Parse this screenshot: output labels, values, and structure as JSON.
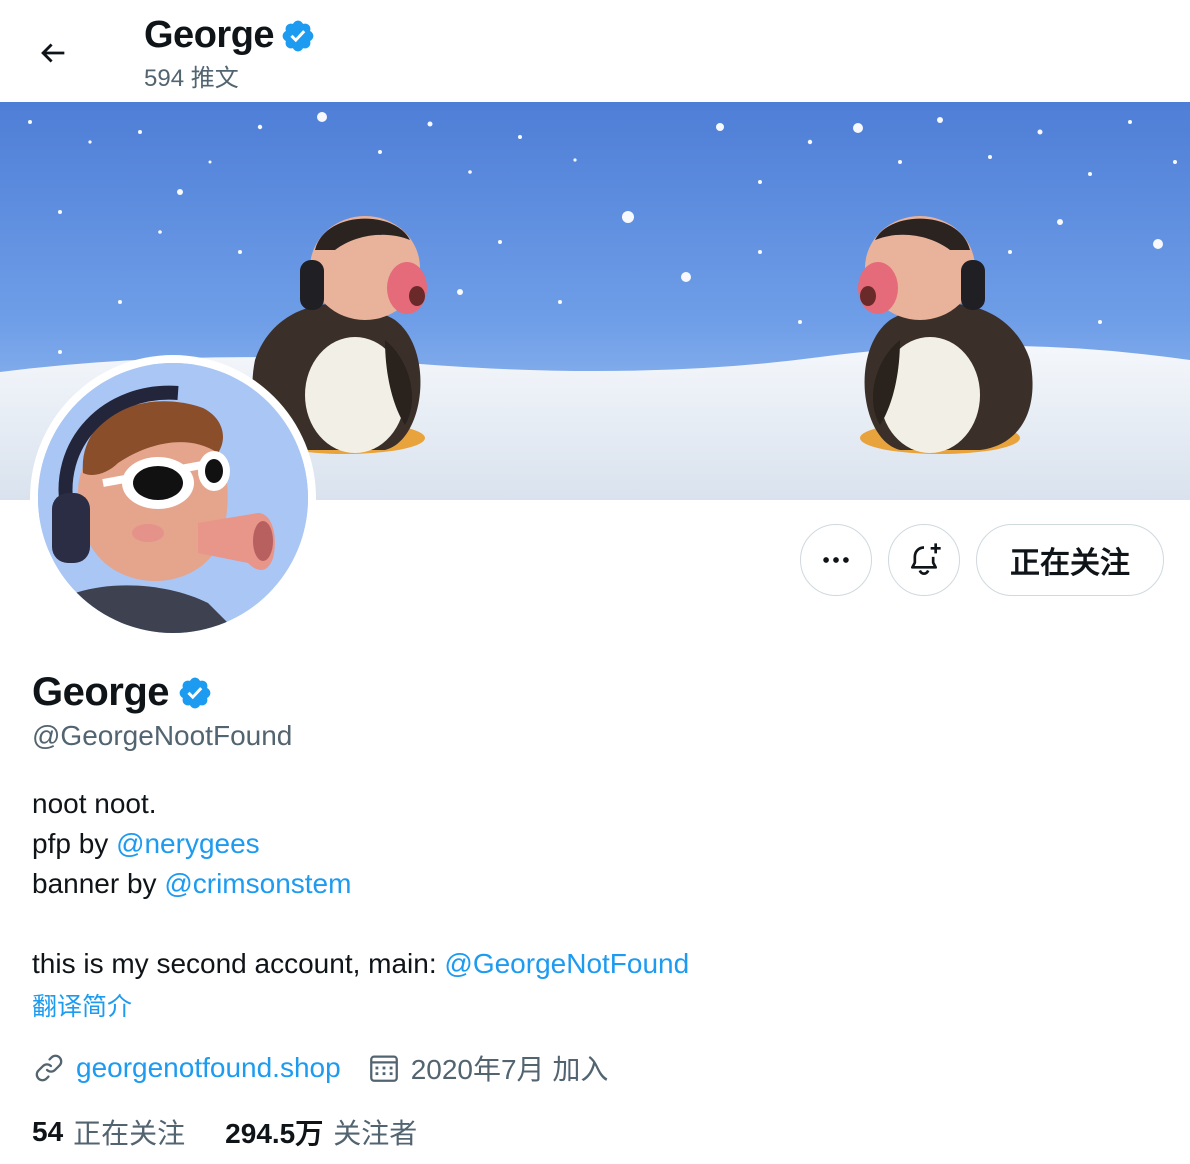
{
  "header": {
    "name": "George",
    "tweet_count": "594 推文",
    "back_icon": "arrow-left-icon",
    "verified_icon": "verified-badge-icon"
  },
  "profile": {
    "name": "George",
    "handle": "@GeorgeNootFound",
    "bio": {
      "line1": "noot noot.",
      "line2_prefix": "pfp by ",
      "line2_link": "@nerygees",
      "line3_prefix": "banner by ",
      "line3_link": "@crimsonstem",
      "line4_prefix": "this is my second account, main: ",
      "line4_link": "@GeorgeNotFound"
    },
    "translate": "翻译简介",
    "website": "georgenotfound.shop",
    "joined": "2020年7月 加入"
  },
  "actions": {
    "more_icon": "more-icon",
    "notify_icon": "bell-plus-icon",
    "following_label": "正在关注"
  },
  "stats": {
    "following_count": "54",
    "following_label": "正在关注",
    "followers_count": "294.5万",
    "followers_label": "关注者"
  },
  "colors": {
    "accent": "#1d9bf0",
    "secondary_text": "#536471",
    "border": "#cfd9de"
  }
}
